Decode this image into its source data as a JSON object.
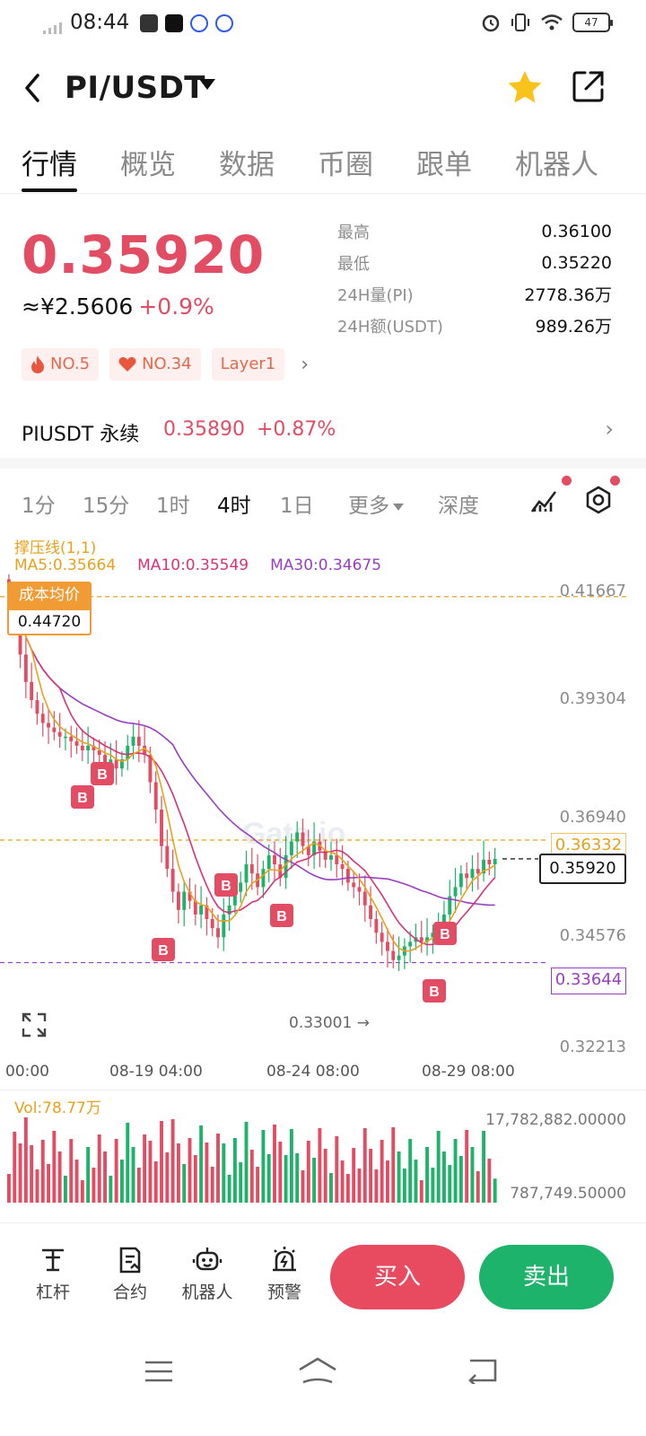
{
  "status_bar": {
    "time": "08:44",
    "battery": "47"
  },
  "header": {
    "pair": "PI/USDT"
  },
  "tabs": [
    "行情",
    "概览",
    "数据",
    "币圈",
    "跟单",
    "机器人"
  ],
  "price": {
    "last": "0.35920",
    "cny": "≈¥2.5606",
    "change": "+0.9%"
  },
  "stats": [
    {
      "label": "最高",
      "value": "0.36100"
    },
    {
      "label": "最低",
      "value": "0.35220"
    },
    {
      "label": "24H量(PI)",
      "value": "2778.36万"
    },
    {
      "label": "24H额(USDT)",
      "value": "989.26万"
    }
  ],
  "tags": [
    {
      "icon": "fire-icon",
      "label": "NO.5"
    },
    {
      "icon": "heart-icon",
      "label": "NO.34"
    },
    {
      "icon": "",
      "label": "Layer1"
    }
  ],
  "perpetual": {
    "name": "PIUSDT 永续",
    "price": "0.35890",
    "change": "+0.87%"
  },
  "intervals": {
    "items": [
      "1分",
      "15分",
      "1时",
      "4时",
      "1日"
    ],
    "active": "4时",
    "more": "更多",
    "depth": "深度"
  },
  "chart": {
    "legend_sr": "撑压线(1,1)",
    "ma5": "MA5:0.35664",
    "ma10": "MA10:0.35549",
    "ma30": "MA30:0.34675",
    "cost_label": "成本均价",
    "cost_value": "0.44720",
    "y_labels": [
      "0.41667",
      "0.39304",
      "0.36940",
      "0.34576",
      "0.32213"
    ],
    "resistance": "0.36332",
    "support": "0.33644",
    "last_price_box": "0.35920",
    "low_marker": "0.33001 →",
    "x_labels": [
      "00:00",
      "08-19 04:00",
      "08-24 08:00",
      "08-29 08:00"
    ],
    "buy_marker": "B",
    "watermark": "Gate.io"
  },
  "volume": {
    "legend": "Vol:78.77万",
    "y_max": "17,782,882.00000",
    "y_min": "787,749.50000"
  },
  "chart_data": {
    "type": "candlestick",
    "ylim": [
      0.32213,
      0.41667
    ],
    "y_ticks": [
      0.41667,
      0.39304,
      0.3694,
      0.34576,
      0.32213
    ],
    "x_ticks": [
      "00:00",
      "08-19 04:00",
      "08-24 08:00",
      "08-29 08:00"
    ],
    "close": [
      0.4175,
      0.412,
      0.404,
      0.398,
      0.394,
      0.391,
      0.389,
      0.388,
      0.387,
      0.386,
      0.386,
      0.385,
      0.384,
      0.383,
      0.384,
      0.383,
      0.382,
      0.38,
      0.381,
      0.379,
      0.381,
      0.384,
      0.386,
      0.384,
      0.382,
      0.376,
      0.37,
      0.362,
      0.357,
      0.352,
      0.348,
      0.352,
      0.35,
      0.347,
      0.349,
      0.346,
      0.344,
      0.342,
      0.347,
      0.349,
      0.352,
      0.354,
      0.358,
      0.356,
      0.353,
      0.357,
      0.36,
      0.358,
      0.355,
      0.36,
      0.363,
      0.365,
      0.362,
      0.36,
      0.363,
      0.361,
      0.359,
      0.36,
      0.358,
      0.357,
      0.354,
      0.353,
      0.352,
      0.349,
      0.346,
      0.343,
      0.341,
      0.339,
      0.337,
      0.338,
      0.34,
      0.341,
      0.342,
      0.341,
      0.342,
      0.343,
      0.345,
      0.347,
      0.351,
      0.353,
      0.356,
      0.355,
      0.357,
      0.356,
      0.359,
      0.358,
      0.3592
    ],
    "ma5": 0.35664,
    "ma10": 0.35549,
    "ma30": 0.34675,
    "lines": {
      "cost": 0.4472,
      "resistance": 0.36332,
      "support": 0.33644,
      "last": 0.3592
    },
    "buy_markers": 8,
    "volume_range": [
      787749.5,
      17782882.0
    ]
  },
  "bottom_bar": {
    "items": [
      {
        "icon": "leverage-icon",
        "label": "杠杆"
      },
      {
        "icon": "contract-icon",
        "label": "合约"
      },
      {
        "icon": "robot-icon",
        "label": "机器人"
      },
      {
        "icon": "alert-icon",
        "label": "预警"
      }
    ],
    "buy": "买入",
    "sell": "卖出"
  }
}
